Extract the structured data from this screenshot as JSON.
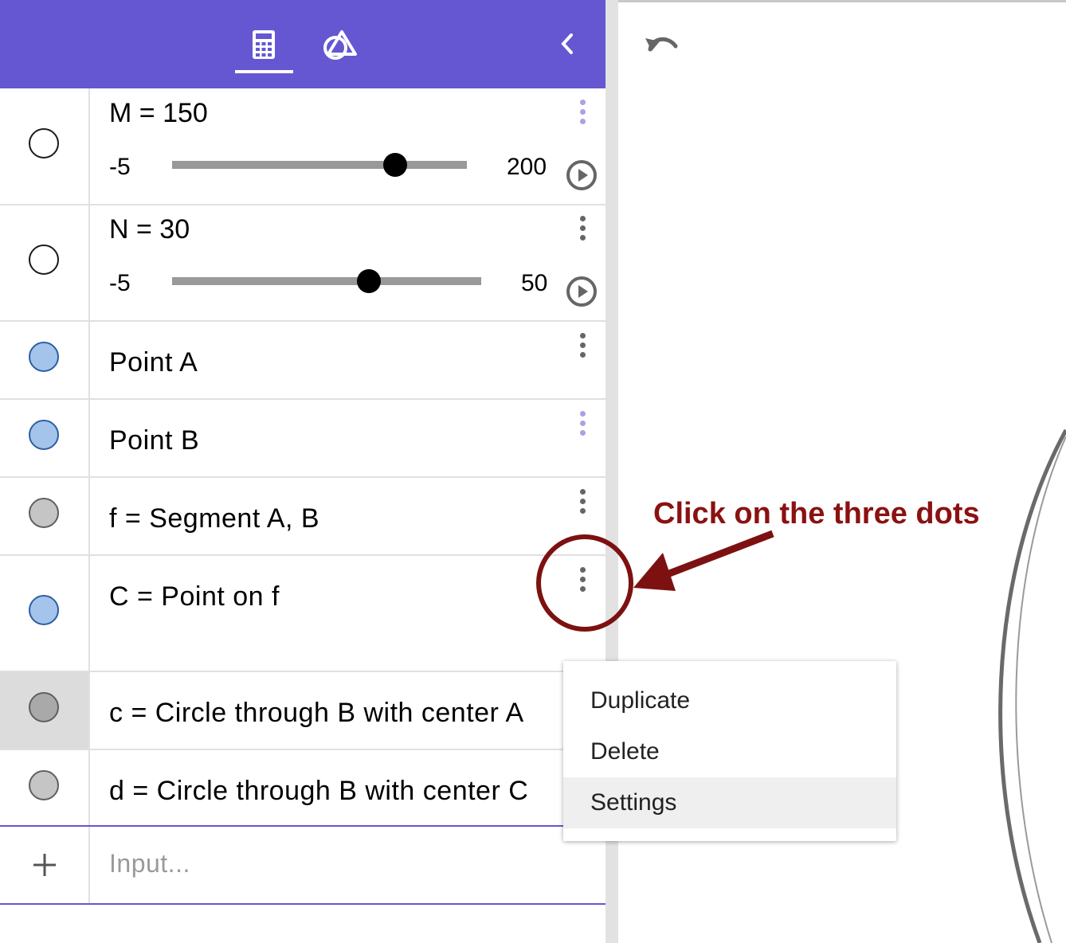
{
  "toolbar": {
    "tabs": [
      {
        "icon": "calculator-icon",
        "selected": true
      },
      {
        "icon": "geometry-tools-icon",
        "selected": false
      }
    ],
    "collapse_icon": "chevron-left-icon",
    "color": "#6557d2"
  },
  "graphics": {
    "undo_icon": "undo-icon"
  },
  "algebra": {
    "sliders": [
      {
        "label": "M = 150",
        "min": "-5",
        "max": "200",
        "value": 150,
        "min_value": -5,
        "max_value": 200
      },
      {
        "label": "N = 30",
        "min": "-5",
        "max": "50",
        "value": 30,
        "min_value": -5,
        "max_value": 50
      }
    ],
    "items": [
      {
        "label": "Point A",
        "marble": "blue"
      },
      {
        "label": "Point B",
        "marble": "blue"
      },
      {
        "label": "f = Segment A, B",
        "marble": "grey"
      },
      {
        "label": "C = Point on f",
        "marble": "blue"
      },
      {
        "label": "c = Circle through B with center A",
        "marble": "grey",
        "selected": true
      },
      {
        "label": "d = Circle through B with center C",
        "marble": "grey"
      }
    ],
    "input_placeholder": "Input..."
  },
  "context_menu": {
    "items": [
      "Duplicate",
      "Delete",
      "Settings"
    ],
    "highlighted": "Settings"
  },
  "annotation": {
    "text": "Click on the three dots",
    "color": "#8b1111"
  }
}
